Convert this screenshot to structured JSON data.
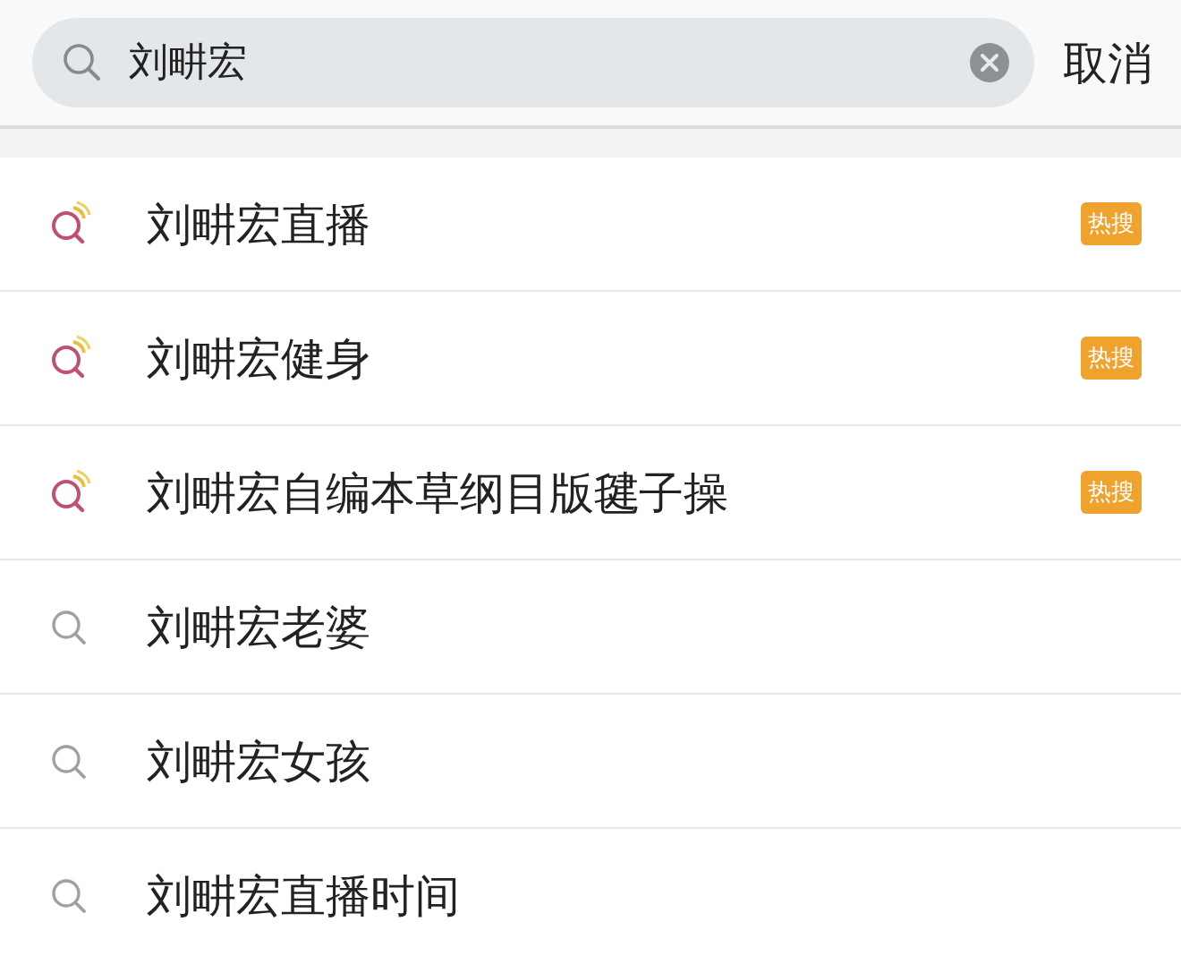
{
  "search": {
    "value": "刘畊宏",
    "cancel": "取消"
  },
  "suggestions": [
    {
      "kind": "hot",
      "text": "刘畊宏直播",
      "badge": "热搜"
    },
    {
      "kind": "hot",
      "text": "刘畊宏健身",
      "badge": "热搜"
    },
    {
      "kind": "hot",
      "text": "刘畊宏自编本草纲目版毽子操",
      "badge": "热搜"
    },
    {
      "kind": "normal",
      "text": "刘畊宏老婆"
    },
    {
      "kind": "normal",
      "text": "刘畊宏女孩"
    },
    {
      "kind": "normal",
      "text": "刘畊宏直播时间"
    }
  ]
}
